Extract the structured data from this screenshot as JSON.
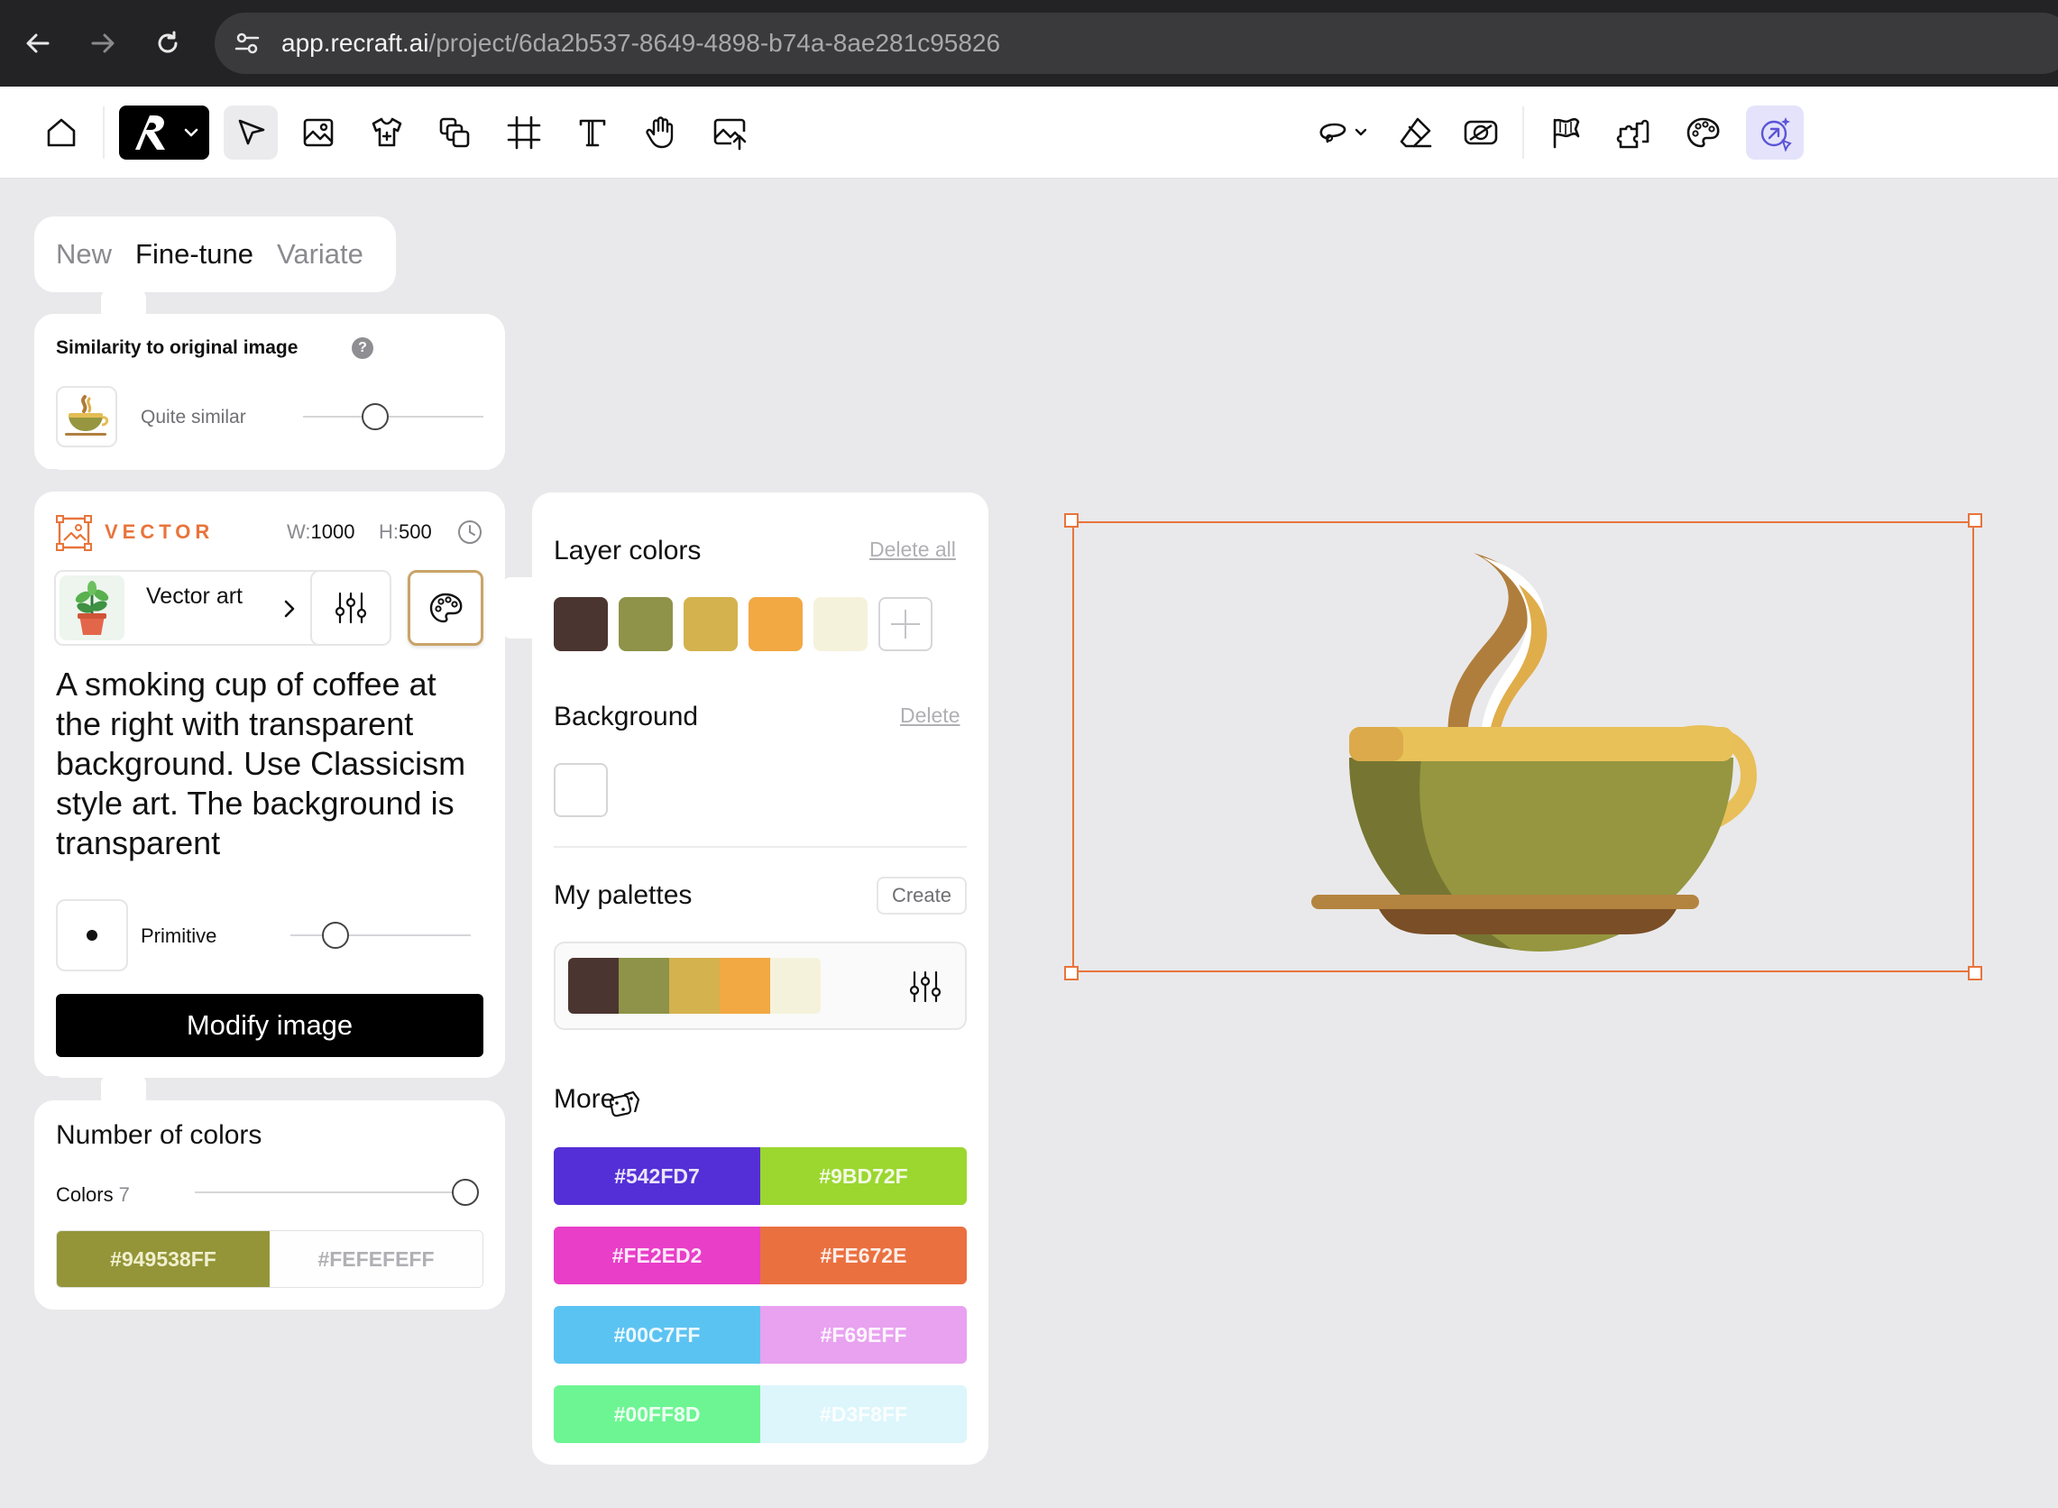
{
  "browser": {
    "url_host": "app.recraft.ai",
    "url_path": "/project/6da2b537-8649-4898-b74a-8ae281c95826",
    "icons": [
      "back-arrow-icon",
      "forward-arrow-icon",
      "reload-icon",
      "site-settings-icon"
    ]
  },
  "toolbar": {
    "left_tools": [
      "home-icon",
      "recraft-logo-icon",
      "select-arrow-icon",
      "image-frame-icon",
      "mockup-shirt-icon",
      "layers-icon",
      "crop-frame-icon",
      "text-tool-icon",
      "hand-tool-icon",
      "upload-image-icon"
    ],
    "right_tools": [
      "lasso-icon",
      "eraser-icon",
      "remove-background-icon",
      "mockup-flag-icon",
      "puzzle-icon",
      "palette-icon",
      "vectorize-icon"
    ]
  },
  "tabs": [
    "New",
    "Fine-tune",
    "Variate"
  ],
  "active_tab": "Fine-tune",
  "similarity": {
    "title": "Similarity to original image",
    "help": "?",
    "label": "Quite similar",
    "level": 0.4
  },
  "style": {
    "type_label": "VECTOR",
    "w_label": "W:",
    "w_value": "1000",
    "h_label": "H:",
    "h_value": "500",
    "style_name": "Vector art",
    "prompt": "A smoking cup of coffee at the right with transparent background. Use Classicism style art. The background is transparent",
    "primitive_label": "Primitive",
    "primitive_level": 0.25,
    "modify_button": "Modify image"
  },
  "number_of_colors": {
    "title": "Number of colors",
    "label": "Colors",
    "count": "7",
    "level": 1.0,
    "swatches": [
      {
        "hex": "#949538FF",
        "bg": "#949538",
        "fg": "#f0f0d0"
      },
      {
        "hex": "#FEFEFEFF",
        "bg": "#fefefe",
        "fg": "#b0b0b4"
      }
    ]
  },
  "palette_panel": {
    "layer_colors_title": "Layer colors",
    "delete_all": "Delete all",
    "layer_colors": [
      "#4a3530",
      "#8e9349",
      "#d4b24e",
      "#f2a843",
      "#f5f2dc"
    ],
    "background_title": "Background",
    "delete": "Delete",
    "my_palettes_title": "My palettes",
    "create": "Create",
    "my_palette": [
      "#4a3530",
      "#8e9349",
      "#d4b24e",
      "#f2a843",
      "#f5f2dc"
    ],
    "more_title": "More",
    "more_rows": [
      [
        {
          "hex": "#542FD7",
          "bg": "#542FD7"
        },
        {
          "hex": "#9BD72F",
          "bg": "#9BD72F"
        }
      ],
      [
        {
          "hex": "#FE2ED2",
          "bg": "#e83ec8"
        },
        {
          "hex": "#FE672E",
          "bg": "#ea7040"
        }
      ],
      [
        {
          "hex": "#00C7FF",
          "bg": "#5bc3f2"
        },
        {
          "hex": "#F69EFF",
          "bg": "#e8a2f0"
        }
      ],
      [
        {
          "hex": "#00FF8D",
          "bg": "#6df593"
        },
        {
          "hex": "#D3F8FF",
          "bg": "#dcf6fb"
        }
      ]
    ]
  }
}
